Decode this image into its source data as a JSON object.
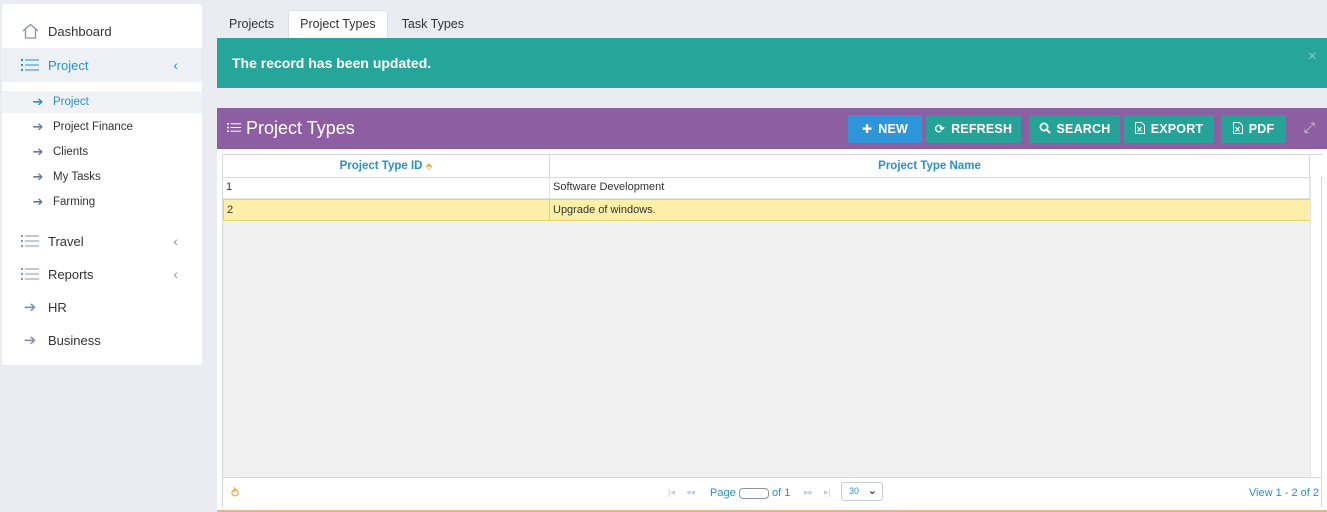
{
  "sidebar": {
    "dashboard": "Dashboard",
    "project": "Project",
    "project_sub": [
      "Project",
      "Project Finance",
      "Clients",
      "My Tasks",
      "Farming"
    ],
    "travel": "Travel",
    "reports": "Reports",
    "hr": "HR",
    "business": "Business"
  },
  "tabs": [
    "Projects",
    "Project Types",
    "Task Types"
  ],
  "alert": {
    "message": "The record has been updated.",
    "close": "×"
  },
  "panel": {
    "title": "Project Types",
    "buttons": {
      "new": "NEW",
      "refresh": "REFRESH",
      "search": "SEARCH",
      "export": "EXPORT",
      "pdf": "PDF"
    }
  },
  "grid": {
    "columns": [
      "Project Type ID",
      "Project Type Name"
    ],
    "rows": [
      [
        "1",
        "Software Development"
      ],
      [
        "2",
        "Upgrade of windows."
      ]
    ],
    "selected_row": 1
  },
  "pager": {
    "page_label": "Page",
    "of_label": "of 1",
    "page_size": "30",
    "view_label": "View 1 - 2 of 2"
  },
  "colors": {
    "alert": "#26a69a",
    "panel_header": "#8e5ea2",
    "new_button": "#2e95d8",
    "teal_button": "#25a396",
    "accent": "#2a8fd0"
  }
}
